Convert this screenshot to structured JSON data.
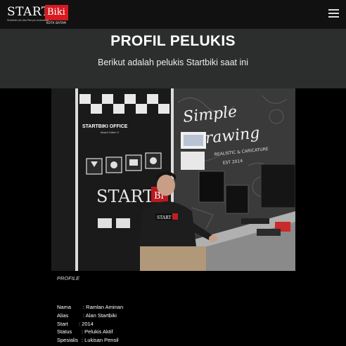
{
  "header": {
    "logo": {
      "text": "START",
      "box_text": "Biki",
      "tagline": "Startbiki art jiko Penyar indonesia",
      "city": "KOTA BATAM",
      "brand_color": "#d71920"
    },
    "menu_icon": "hamburger-icon"
  },
  "hero": {
    "title": "PROFIL PELUKIS",
    "subtitle": "Berikut adalah pelukis Startbiki saat ini"
  },
  "photo": {
    "wall_text": "Simple Drawing",
    "wall_sub": "REALISTIC & CARICATURE",
    "wall_est": "EST 2014",
    "banner_title": "STARTBIKI OFFICE",
    "banner_sub": "Mazid Galeri II",
    "banner_logo": "START",
    "banner_logo_box": "Bi",
    "shirt_text": "START"
  },
  "profile": {
    "caption": "PROFILE",
    "fields": [
      {
        "label": "Nama",
        "value": ": Ramlan Aminan"
      },
      {
        "label": "Alias",
        "value": ": Alan Startbiki"
      },
      {
        "label": "Start",
        "value": ": 2014"
      },
      {
        "label": "Status",
        "value": ": Pelukis Aktif"
      },
      {
        "label": "Spesialis",
        "value": ": Lukisan Pensil"
      }
    ]
  }
}
